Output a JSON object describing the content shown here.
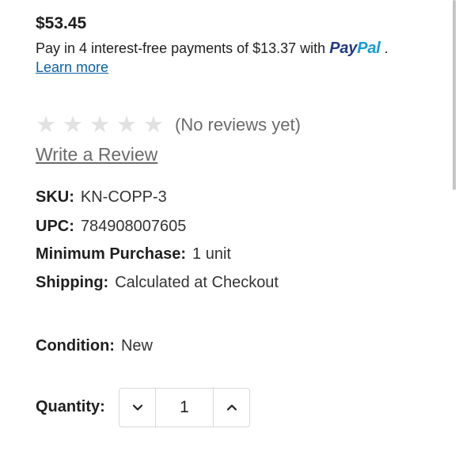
{
  "product": {
    "price": "$53.45"
  },
  "paypal": {
    "text_before": "Pay in 4 interest-free payments of $13.37 with",
    "logo_pay": "Pay",
    "logo_pal": "Pal",
    "text_after": ".",
    "learn_more": "Learn more"
  },
  "rating": {
    "stars_filled": 0,
    "stars_total": 5,
    "star_char": "★",
    "reviews_text": "(No reviews yet)",
    "write_review": "Write a Review"
  },
  "specs": {
    "sku_label": "SKU:",
    "sku_value": "KN-COPP-3",
    "upc_label": "UPC:",
    "upc_value": "784908007605",
    "min_label": "Minimum Purchase:",
    "min_value": "1 unit",
    "shipping_label": "Shipping:",
    "shipping_value": "Calculated at Checkout",
    "condition_label": "Condition:",
    "condition_value": "New"
  },
  "quantity": {
    "label": "Quantity:",
    "value": "1"
  },
  "colors": {
    "paypal_dark": "#253b80",
    "paypal_light": "#179bd7",
    "link": "#0b62a4",
    "star_empty": "#e1e1e1"
  },
  "icons": {
    "decrement": "chevron-down-icon",
    "increment": "chevron-up-icon"
  }
}
